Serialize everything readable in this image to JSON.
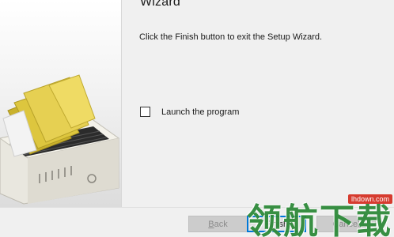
{
  "wizard": {
    "title": "Wizard",
    "message": "Click the Finish button to exit the Setup Wizard.",
    "launch_label": "Launch the program",
    "launch_checked": false
  },
  "buttons": {
    "back": {
      "prefix": "",
      "accel": "B",
      "rest": "ack"
    },
    "finish": {
      "prefix": "",
      "accel": "F",
      "rest": "inish"
    },
    "cancel": {
      "label": "Cancel"
    }
  },
  "watermark": {
    "cn_text": "领航下载",
    "url": "lhdown.com"
  },
  "colors": {
    "folder_yellow": "#d9c23a",
    "default_button_border": "#0078d7",
    "watermark_green": "#2f8a3a",
    "watermark_red": "#d63b2f"
  },
  "icons": {
    "art": "folder-in-drive-illustration"
  }
}
